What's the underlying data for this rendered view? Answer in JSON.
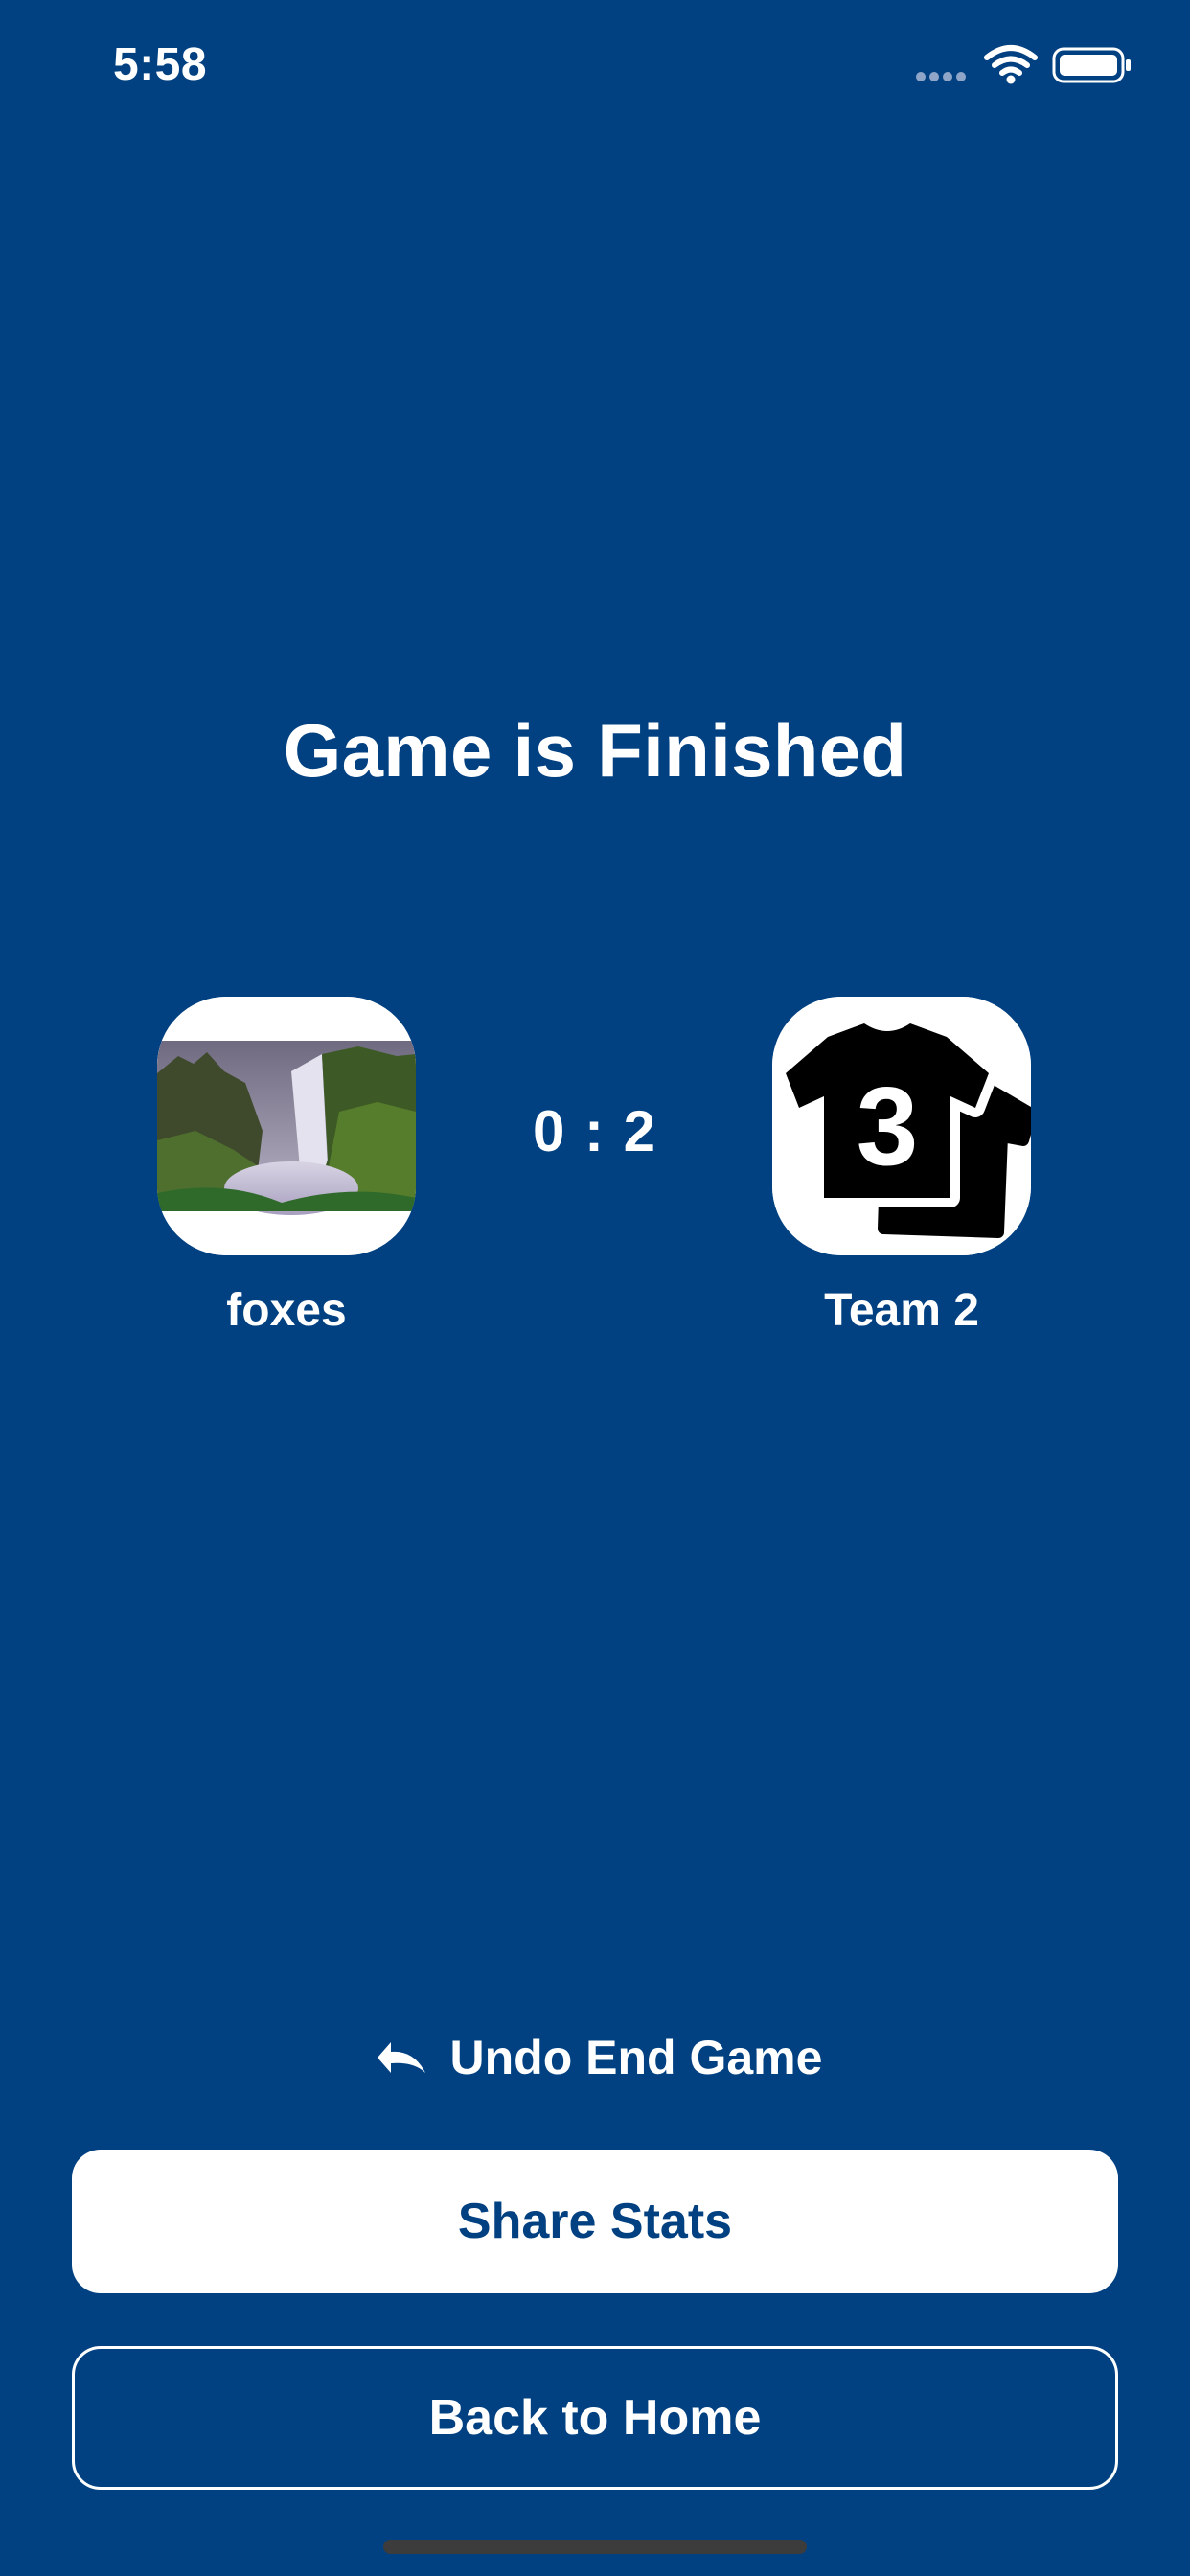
{
  "status_bar": {
    "time": "5:58"
  },
  "title": "Game is Finished",
  "home_team": {
    "name": "foxes",
    "logo": "waterfall-photo"
  },
  "away_team": {
    "name": "Team 2",
    "logo": "jersey-3-icon",
    "jersey_number": "3"
  },
  "score": "0 : 2",
  "actions": {
    "undo_label": "Undo End Game",
    "share_label": "Share Stats",
    "home_label": "Back to Home"
  },
  "colors": {
    "background": "#024181",
    "button_text": "#024181",
    "white": "#ffffff"
  }
}
